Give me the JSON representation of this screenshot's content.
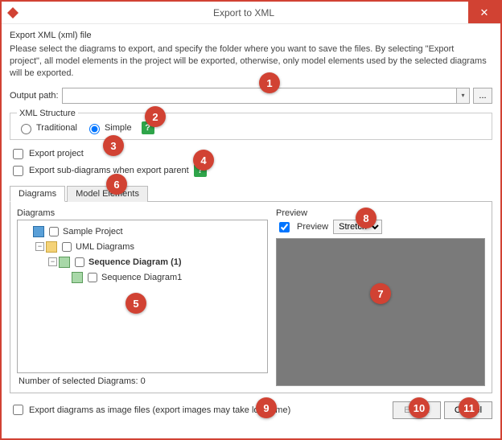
{
  "window": {
    "title": "Export to XML"
  },
  "heading": "Export XML (xml) file",
  "description": "Please select the diagrams to export, and specify the folder where you want to save the files. By selecting \"Export project\", all model elements in the project will be exported, otherwise, only model elements used by the selected diagrams will be exported.",
  "output_path": {
    "label": "Output path:",
    "value": "",
    "browse": "..."
  },
  "xml_structure": {
    "legend": "XML Structure",
    "traditional": "Traditional",
    "simple": "Simple",
    "selected": "simple"
  },
  "export_project": {
    "label": "Export project",
    "checked": false
  },
  "export_sub": {
    "label": "Export sub-diagrams when export parent",
    "checked": false
  },
  "tabs": {
    "diagrams": "Diagrams",
    "model_elements": "Model Elements",
    "active": "diagrams"
  },
  "diagrams_panel": {
    "group_label": "Diagrams",
    "count_label": "Number of selected Diagrams: 0",
    "tree": {
      "project": "Sample Project",
      "folder": "UML Diagrams",
      "seq1": "Sequence Diagram (1)",
      "seq2": "Sequence Diagram1"
    }
  },
  "preview": {
    "group_label": "Preview",
    "checkbox": "Preview",
    "checked": true,
    "mode": "Stretch"
  },
  "export_images": {
    "label": "Export diagrams as image files (export images may take long time)",
    "checked": false
  },
  "buttons": {
    "export": "Export",
    "cancel": "Cancel"
  },
  "callouts": [
    "1",
    "2",
    "3",
    "4",
    "5",
    "6",
    "7",
    "8",
    "9",
    "10",
    "11"
  ]
}
